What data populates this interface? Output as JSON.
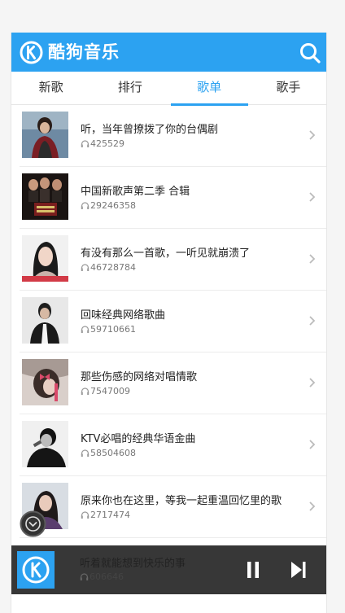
{
  "header": {
    "app_name": "酷狗音乐",
    "brand_color": "#2ca2f1",
    "logo_icon": "kugou-logo-icon",
    "search_icon": "search-icon"
  },
  "tabs": [
    {
      "label": "新歌",
      "active": false
    },
    {
      "label": "排行",
      "active": false
    },
    {
      "label": "歌单",
      "active": true
    },
    {
      "label": "歌手",
      "active": false
    }
  ],
  "playlists": [
    {
      "title": "听，当年曾撩拨了你的台偶剧",
      "plays": "425529"
    },
    {
      "title": "中国新歌声第二季 合辑",
      "plays": "29246358"
    },
    {
      "title": "有没有那么一首歌，一听见就崩溃了",
      "plays": "46728784"
    },
    {
      "title": "回味经典网络歌曲",
      "plays": "59710661"
    },
    {
      "title": "那些伤感的网络对唱情歌",
      "plays": "7547009"
    },
    {
      "title": "KTV必唱的经典华语金曲",
      "plays": "58504608"
    },
    {
      "title": "原来你也在这里，等我一起重温回忆里的歌",
      "plays": "2717474"
    }
  ],
  "player": {
    "title": "听着就能想到快乐的事",
    "plays": "606646",
    "controls": [
      "pause-icon",
      "next-icon"
    ]
  }
}
